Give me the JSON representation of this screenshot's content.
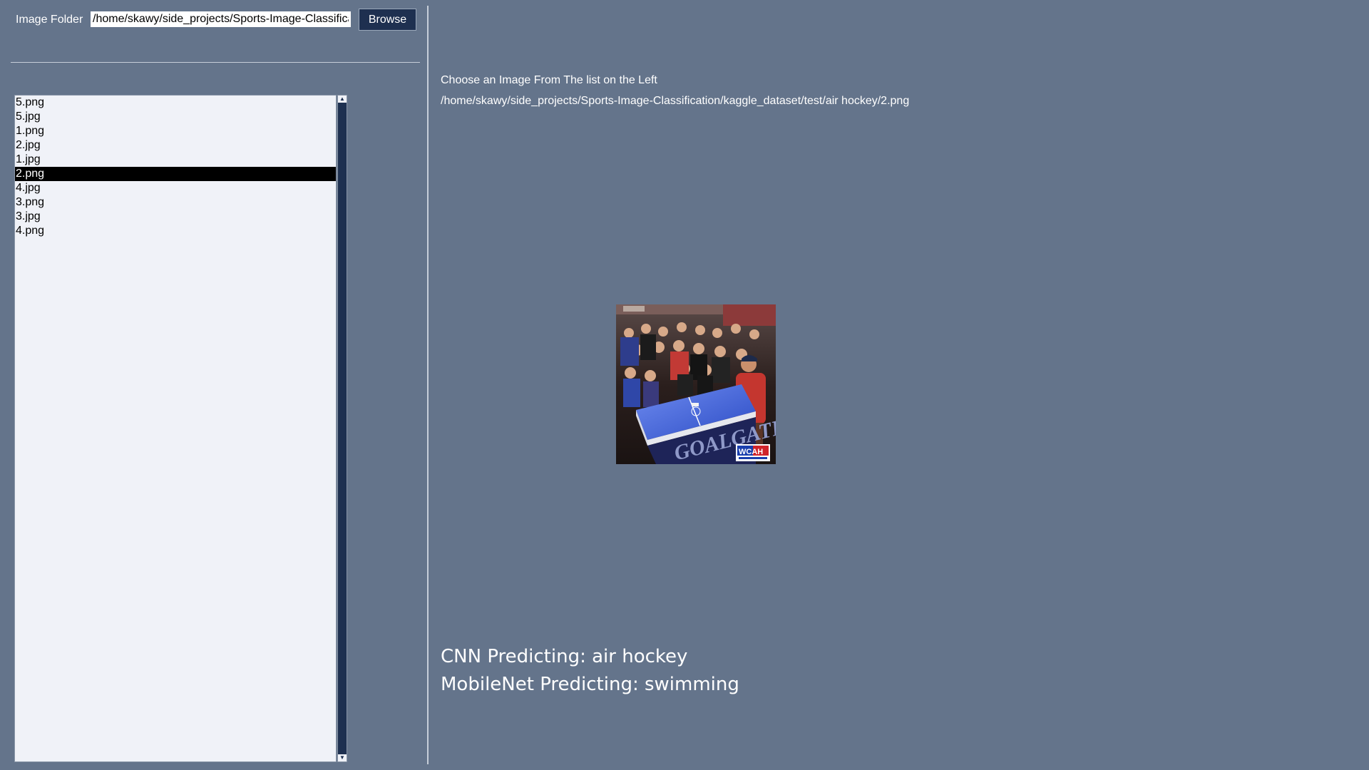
{
  "folder": {
    "label": "Image Folder",
    "path_value": "/home/skawy/side_projects/Sports-Image-Classification/kaggle_dataset/test/air hockey",
    "browse_label": "Browse"
  },
  "file_list": {
    "items": [
      {
        "label": "5.png",
        "selected": false
      },
      {
        "label": "5.jpg",
        "selected": false
      },
      {
        "label": "1.png",
        "selected": false
      },
      {
        "label": "2.jpg",
        "selected": false
      },
      {
        "label": "1.jpg",
        "selected": false
      },
      {
        "label": "2.png",
        "selected": true
      },
      {
        "label": "4.jpg",
        "selected": false
      },
      {
        "label": "3.png",
        "selected": false
      },
      {
        "label": "3.jpg",
        "selected": false
      },
      {
        "label": "4.png",
        "selected": false
      }
    ]
  },
  "viewer": {
    "instruction": "Choose an Image From The list on the Left",
    "selected_path": "/home/skawy/side_projects/Sports-Image-Classification/kaggle_dataset/test/air hockey/2.png",
    "preview_watermark": "WCAH"
  },
  "predictions": {
    "cnn": "CNN Predicting: air hockey",
    "mobilenet": "MobileNet Predicting: swimming"
  },
  "colors": {
    "background": "#64748b",
    "list_background": "#f0f2f8",
    "selection": "#000000",
    "button": "#1e3050",
    "table": "#3a5fd0"
  }
}
